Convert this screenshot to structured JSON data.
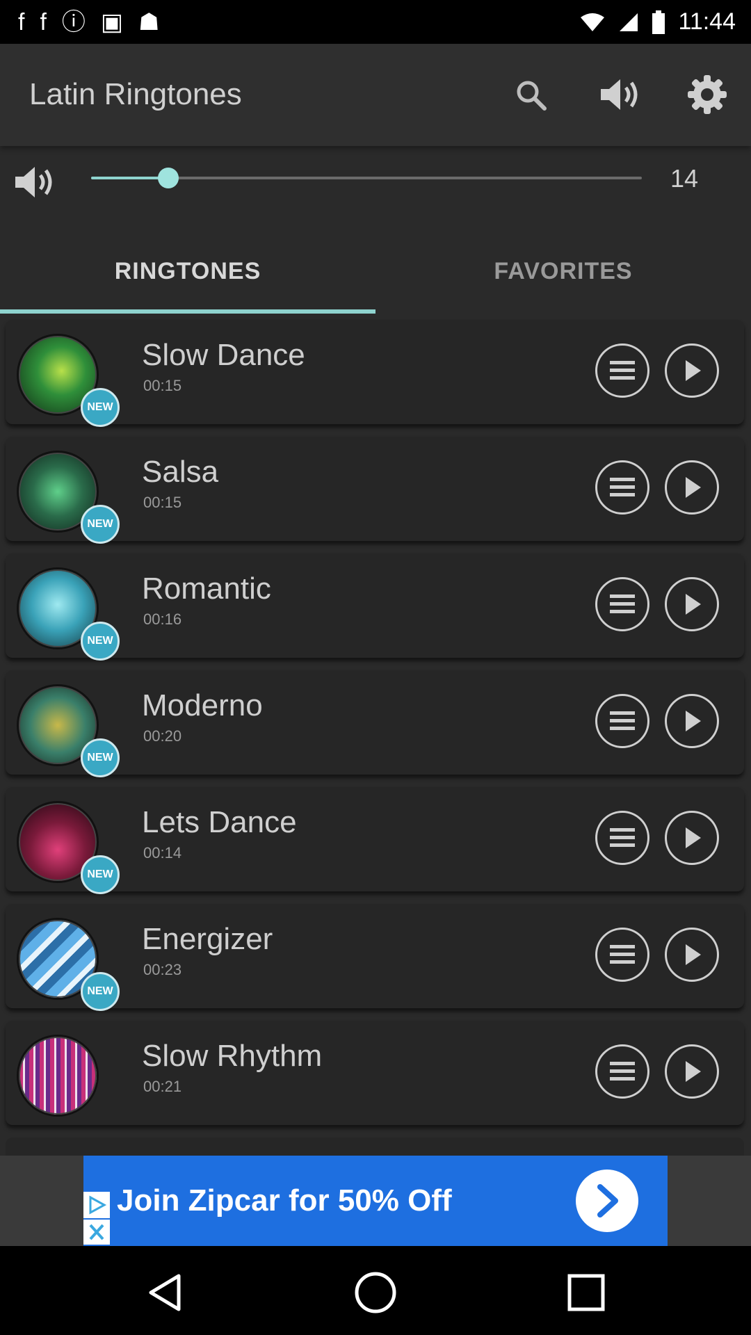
{
  "status_bar": {
    "time": "11:44"
  },
  "app_bar": {
    "title": "Latin Ringtones",
    "icons": [
      "search-icon",
      "volume-icon",
      "settings-icon"
    ]
  },
  "volume": {
    "value": "14",
    "level": 0.14
  },
  "tabs": {
    "ringtones": "RINGTONES",
    "favorites": "FAVORITES",
    "active": "ringtones"
  },
  "ringtones": [
    {
      "title": "Slow Dance",
      "duration": "00:15",
      "badge": "NEW"
    },
    {
      "title": "Salsa",
      "duration": "00:15",
      "badge": "NEW"
    },
    {
      "title": "Romantic",
      "duration": "00:16",
      "badge": "NEW"
    },
    {
      "title": "Moderno",
      "duration": "00:20",
      "badge": "NEW"
    },
    {
      "title": "Lets Dance",
      "duration": "00:14",
      "badge": "NEW"
    },
    {
      "title": "Energizer",
      "duration": "00:23",
      "badge": "NEW"
    },
    {
      "title": "Slow Rhythm",
      "duration": "00:21",
      "badge": ""
    }
  ],
  "ad": {
    "text": "Join Zipcar for 50% Off"
  },
  "colors": {
    "accent": "#8fd4cf",
    "background": "#2a2a2a",
    "ad_blue": "#1e6fe0"
  }
}
